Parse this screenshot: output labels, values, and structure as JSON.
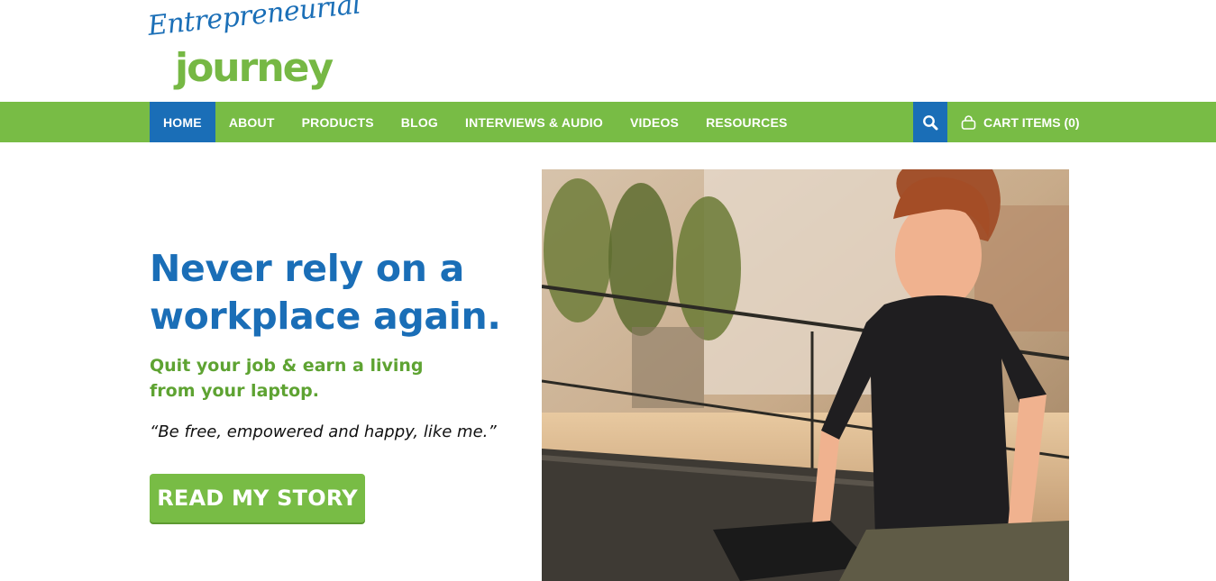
{
  "logo": {
    "script": "Entrepreneurial",
    "word": "journey"
  },
  "nav": {
    "items": [
      {
        "label": "HOME",
        "active": true
      },
      {
        "label": "ABOUT",
        "active": false
      },
      {
        "label": "PRODUCTS",
        "active": false
      },
      {
        "label": "BLOG",
        "active": false
      },
      {
        "label": "INTERVIEWS & AUDIO",
        "active": false
      },
      {
        "label": "VIDEOS",
        "active": false
      },
      {
        "label": "RESOURCES",
        "active": false
      }
    ],
    "search_icon": "search-icon",
    "cart_label": "CART ITEMS (0)",
    "cart_icon": "shopping-bag-icon"
  },
  "hero": {
    "headline_line1": "Never rely on a",
    "headline_line2": "workplace again.",
    "subhead": "Quit your job & earn a living from your laptop.",
    "quote": "“Be free, empowered and happy, like me.”",
    "cta_label": "READ MY STORY"
  },
  "colors": {
    "brand_green": "#78bc45",
    "brand_blue": "#1a6eb7",
    "subhead_green": "#5ea332"
  }
}
